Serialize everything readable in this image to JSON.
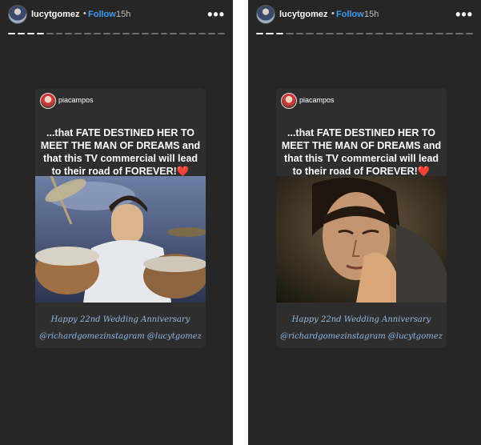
{
  "stories": [
    {
      "username": "lucytgomez",
      "separator": "•",
      "follow_label": "Follow",
      "time": "15h",
      "more_label": "•••",
      "progress": {
        "total": 23,
        "viewed": 4
      },
      "embedded_post": {
        "username": "piacampos",
        "caption": "...that FATE DESTINED HER TO MEET THE MAN OF DREAMS and that this TV commercial will lead to their road of FOREVER!",
        "emoji": "❤️",
        "greeting": "Happy 22nd Wedding Anniversary",
        "tags": "@richardgomezinstagram @lucytgomez"
      }
    },
    {
      "username": "lucytgomez",
      "separator": "•",
      "follow_label": "Follow",
      "time": "15h",
      "more_label": "•••",
      "progress": {
        "total": 22,
        "viewed": 3
      },
      "embedded_post": {
        "username": "piacampos",
        "caption": "...that FATE DESTINED HER TO MEET THE MAN OF DREAMS and that this TV commercial will lead to their road of FOREVER!",
        "emoji": "❤️",
        "greeting": "Happy 22nd Wedding Anniversary",
        "tags": "@richardgomezinstagram @lucytgomez"
      }
    }
  ]
}
